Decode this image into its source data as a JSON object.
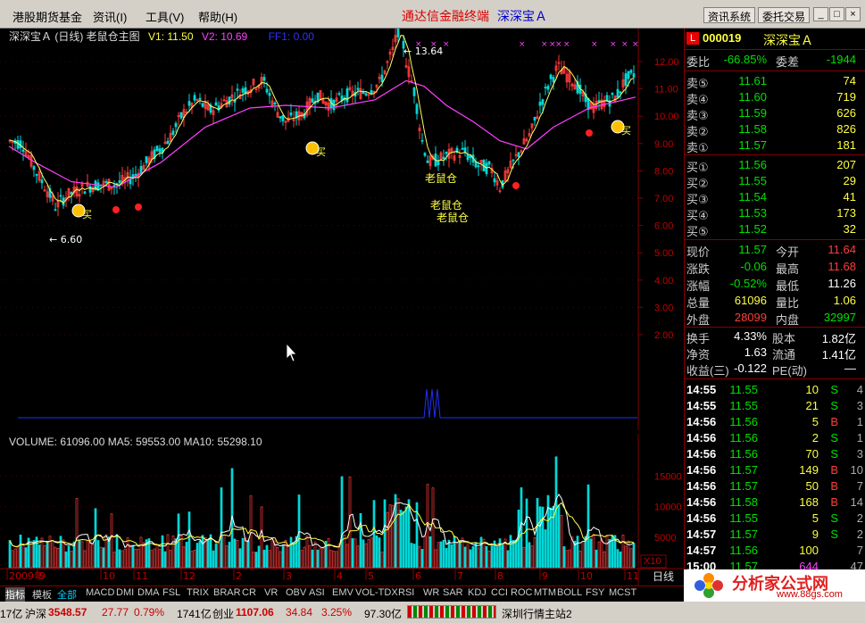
{
  "menu": {
    "items": [
      "港股期货基金",
      "资讯(I)",
      "工具(V)",
      "帮助(H)"
    ],
    "title": "通达信金融终端",
    "subtitle": "深深宝Ａ",
    "btn_news": "资讯系统",
    "btn_trade": "委托交易"
  },
  "chart": {
    "header_name": "深深宝Ａ (日线) 老鼠仓主图",
    "v1": "V1: 11.50",
    "v2": "V2: 10.69",
    "ff1": "FF1: 0.00",
    "high_label": "13.64",
    "low_label": "6.60",
    "signal_mouse": "老鼠仓",
    "signal_buy": "买",
    "price_ticks": [
      "12.00",
      "11.00",
      "10.00",
      "9.00",
      "8.00",
      "7.00",
      "6.00",
      "5.00",
      "4.00",
      "3.00",
      "2.00"
    ],
    "vol_header": "VOLUME: 61096.00  MA5: 59553.00  MA10: 55298.10",
    "vol_ticks": [
      "15000",
      "10000",
      "5000"
    ],
    "vol_unit": "X10",
    "x_labels": [
      "2009年",
      "9",
      "10",
      "11",
      "12",
      "2",
      "3",
      "4",
      "5",
      "6",
      "7",
      "8",
      "9",
      "10",
      "11"
    ],
    "period": "日线"
  },
  "chart_data": {
    "type": "line",
    "title": "深深宝Ａ (日线) 老鼠仓主图",
    "x": [
      "2009-08",
      "2009-09",
      "2009-10",
      "2009-11",
      "2009-12",
      "2010-02",
      "2010-03",
      "2010-04",
      "2010-05",
      "2010-06",
      "2010-07",
      "2010-08",
      "2010-09",
      "2010-10",
      "2010-11"
    ],
    "series": [
      {
        "name": "V1",
        "values": [
          7.4,
          7.2,
          8.0,
          9.8,
          10.6,
          10.2,
          10.9,
          12.8,
          9.0,
          8.3,
          8.6,
          11.5,
          11.3,
          10.8,
          11.5
        ]
      },
      {
        "name": "V2",
        "values": [
          8.6,
          7.6,
          7.7,
          8.9,
          9.8,
          10.1,
          10.4,
          11.4,
          10.4,
          9.2,
          8.7,
          9.9,
          10.6,
          10.7,
          10.7
        ]
      }
    ],
    "ylim": [
      2,
      13
    ],
    "volume": {
      "MA5": 59553,
      "MA10": 55298.1,
      "last": 61096
    }
  },
  "quote": {
    "code": "000019",
    "name": "深深宝Ａ",
    "ratio_lab": "委比",
    "ratio_val": "-66.85%",
    "diff_lab": "委差",
    "diff_val": "-1944",
    "asks": [
      {
        "lab": "卖⑤",
        "price": "11.61",
        "vol": "74"
      },
      {
        "lab": "卖④",
        "price": "11.60",
        "vol": "719"
      },
      {
        "lab": "卖③",
        "price": "11.59",
        "vol": "626"
      },
      {
        "lab": "卖②",
        "price": "11.58",
        "vol": "826"
      },
      {
        "lab": "卖①",
        "price": "11.57",
        "vol": "181"
      }
    ],
    "bids": [
      {
        "lab": "买①",
        "price": "11.56",
        "vol": "207"
      },
      {
        "lab": "买②",
        "price": "11.55",
        "vol": "29"
      },
      {
        "lab": "买③",
        "price": "11.54",
        "vol": "41"
      },
      {
        "lab": "买④",
        "price": "11.53",
        "vol": "173"
      },
      {
        "lab": "买⑤",
        "price": "11.52",
        "vol": "32"
      }
    ],
    "stats": [
      {
        "l1": "现价",
        "v1": "11.57",
        "l2": "今开",
        "v2": "11.64"
      },
      {
        "l1": "涨跌",
        "v1": "-0.06",
        "l2": "最高",
        "v2": "11.68"
      },
      {
        "l1": "涨幅",
        "v1": "-0.52%",
        "l2": "最低",
        "v2": "11.26"
      },
      {
        "l1": "总量",
        "v1": "61096",
        "l2": "量比",
        "v2": "1.06"
      },
      {
        "l1": "外盘",
        "v1": "28099",
        "l2": "内盘",
        "v2": "32997"
      }
    ],
    "stats2": [
      {
        "l1": "换手",
        "v1": "4.33%",
        "l2": "股本",
        "v2": "1.82亿"
      },
      {
        "l1": "净资",
        "v1": "1.63",
        "l2": "流通",
        "v2": "1.41亿"
      },
      {
        "l1": "收益(三)",
        "v1": "-0.122",
        "l2": "PE(动)",
        "v2": "—"
      }
    ],
    "ticks": [
      {
        "t": "14:55",
        "p": "11.55",
        "v": "10",
        "s": "S",
        "n": "4"
      },
      {
        "t": "14:55",
        "p": "11.55",
        "v": "21",
        "s": "S",
        "n": "3"
      },
      {
        "t": "14:56",
        "p": "11.56",
        "v": "5",
        "s": "B",
        "n": "1"
      },
      {
        "t": "14:56",
        "p": "11.56",
        "v": "2",
        "s": "S",
        "n": "1"
      },
      {
        "t": "14:56",
        "p": "11.56",
        "v": "70",
        "s": "S",
        "n": "3"
      },
      {
        "t": "14:56",
        "p": "11.57",
        "v": "149",
        "s": "B",
        "n": "10"
      },
      {
        "t": "14:56",
        "p": "11.57",
        "v": "50",
        "s": "B",
        "n": "7"
      },
      {
        "t": "14:56",
        "p": "11.58",
        "v": "168",
        "s": "B",
        "n": "14"
      },
      {
        "t": "14:56",
        "p": "11.55",
        "v": "5",
        "s": "S",
        "n": "2"
      },
      {
        "t": "14:57",
        "p": "11.57",
        "v": "9",
        "s": "S",
        "n": "2"
      },
      {
        "t": "14:57",
        "p": "11.56",
        "v": "100",
        "s": "",
        "n": "7"
      },
      {
        "t": "15:00",
        "p": "11.57",
        "v": "644",
        "s": "",
        "n": "47"
      }
    ]
  },
  "tabs": [
    "指标",
    "模板",
    "全部",
    "MACD",
    "DMI",
    "DMA",
    "FSL",
    "TRIX",
    "BRAR",
    "CR",
    "VR",
    "OBV",
    "ASI",
    "EMV",
    "VOL-TDX",
    "RSI",
    "WR",
    "SAR",
    "KDJ",
    "CCI",
    "ROC",
    "MTM",
    "BOLL",
    "FSY",
    "MCST"
  ],
  "status": {
    "s0": "17亿",
    "sh_lab": "沪深",
    "sh_val": "3548.57",
    "sh_chg": "27.77",
    "sh_pct": "0.79%",
    "sh_amt": "1741亿",
    "cy_lab": "创业",
    "cy_val": "1107.06",
    "cy_chg": "34.84",
    "cy_pct": "3.25%",
    "cy_amt": "97.30亿",
    "server": "深圳行情主站2"
  },
  "logo": {
    "text": "分析家公式网",
    "url_text": "www.88gs.com"
  },
  "colors": {
    "up": "#ff3c3c",
    "down": "#00e0e0",
    "green": "#00d000",
    "yellow": "#ffff40",
    "magenta": "#ff40ff"
  }
}
